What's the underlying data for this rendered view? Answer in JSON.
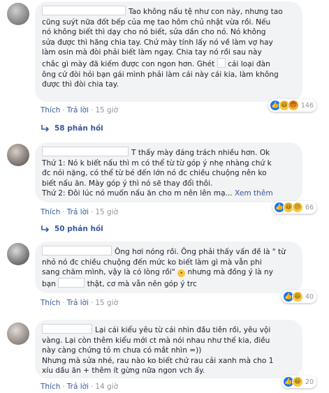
{
  "comments": [
    {
      "lines": [
        "Tao không nấu tệ như con này, nhưng tao",
        "cũng suýt nữa đốt bếp của mẹ tao hôm chủ nhật vừa rồi. Nếu",
        "nó không biết thì dạy cho nó biết, sửa dần cho nó. Nó không",
        "sửa được thì hãng chia tay. Chứ mày tính lấy nó về làm vợ hay",
        "làm osin mà đòi phải biết làm ngay. Chia tay nó rồi sau này",
        "chắc gì mày đã kiếm được con ngon hơn. Ghét",
        "cái loại đàn",
        "ông cứ đòi hỏi bạn gái mình phải làm cái này cái kia, làm không",
        "được thì đòi chia tay."
      ],
      "reaction_count": "146",
      "reactions": [
        "like",
        "haha",
        "angry"
      ],
      "actions": {
        "like": "Thích",
        "reply": "Trả lời",
        "time": "15 giờ"
      },
      "replies": "58 phản hồi"
    },
    {
      "lines": [
        "T thấy mày đáng trách nhiều hơn. Ok",
        "Thứ 1: Nó k biết nấu thì m có thể từ từ góp ý nhẹ nhàng chứ k",
        "đc nói nặng, có thể từ bé đến lớn nó đc chiều chuộng nên ko",
        "biết nấu ăn.  Mày góp ý thì nó sẽ thay đổi thôi.",
        "Thứ 2: Đôi lúc nó muốn nấu ăn cho m nên lên mạ...",
        "Xem thêm"
      ],
      "reaction_count": "66",
      "reactions": [
        "like",
        "haha",
        "sad"
      ],
      "actions": {
        "like": "Thích",
        "reply": "Trả lời",
        "time": "15 giờ"
      },
      "replies": "50 phản hồi"
    },
    {
      "lines": [
        "Ông hơi nóng rồi. Ông phải thấy vấn đề là \" từ",
        "nhỏ nó đc chiều chuộng đến mức ko biết làm gì mà vẫn phi",
        "sang chăm mình, vậy là có lòng rồi\"",
        " nhưng mà đồng ý là ny",
        "bạn",
        "thật, cơ mà vẫn nên góp ý trc"
      ],
      "reaction_count": "40",
      "reactions": [
        "like",
        "haha"
      ],
      "actions": {
        "like": "Thích",
        "reply": "Trả lời",
        "time": "15 giờ"
      }
    },
    {
      "lines": [
        "Lại cái kiểu yêu từ cái nhìn đầu tiên rồi, yêu vội",
        "vàng. Lại còn thêm kiểu mới ct mà nói nhau như thế kia, điều",
        "này càng chứng tỏ m chưa có mắt nhìn =))",
        "Nhưng mà sửa nhé, rau nào ko biết chứ rau cải xanh mà cho 1",
        "xíu dầu ăn + thêm ít gừng nữa ngon vch ấy."
      ],
      "reaction_count": "20",
      "reactions": [
        "like",
        "haha"
      ],
      "actions": {
        "like": "Thích",
        "reply": "Trả lời",
        "time": "14 giờ"
      }
    }
  ]
}
